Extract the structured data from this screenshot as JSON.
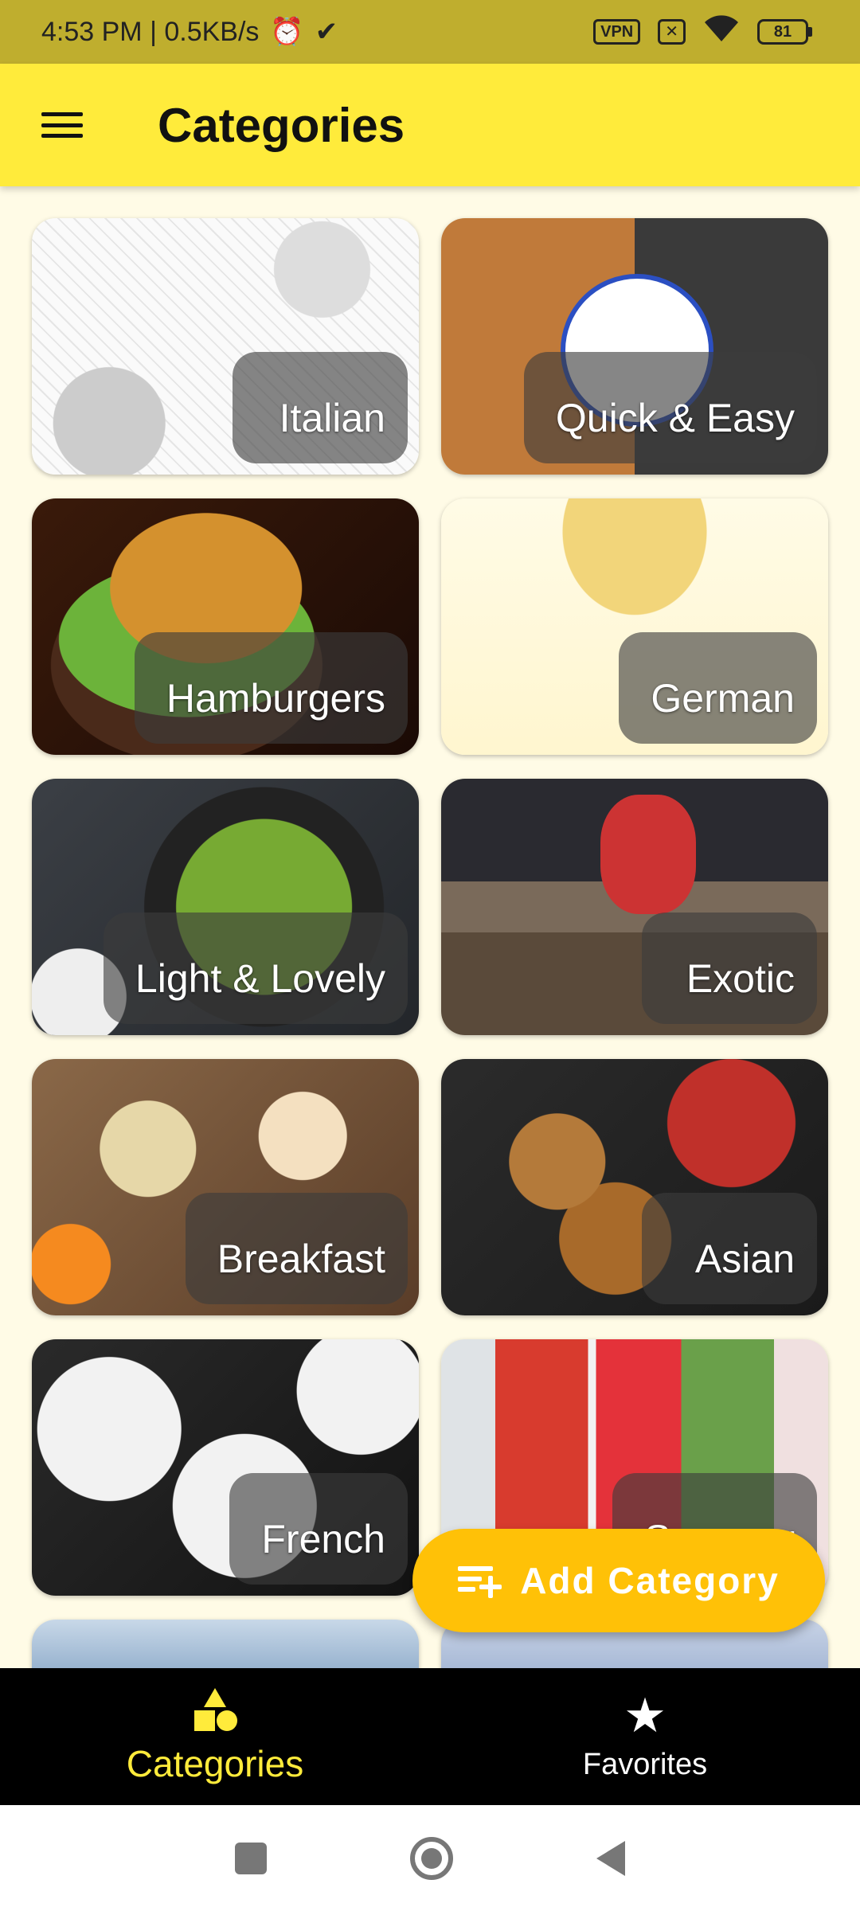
{
  "status_bar": {
    "time_speed": "4:53 PM | 0.5KB/s",
    "alarm_icon": "alarm-clock-icon",
    "vpn_badge": "VPN",
    "battery": "81"
  },
  "app_bar": {
    "title": "Categories",
    "menu_icon": "hamburger-menu-icon"
  },
  "categories": [
    {
      "label": "Italian"
    },
    {
      "label": "Quick & Easy"
    },
    {
      "label": "Hamburgers"
    },
    {
      "label": "German"
    },
    {
      "label": "Light & Lovely"
    },
    {
      "label": "Exotic"
    },
    {
      "label": "Breakfast"
    },
    {
      "label": "Asian"
    },
    {
      "label": "French"
    },
    {
      "label": "Summer"
    }
  ],
  "fab": {
    "label": "Add Category",
    "icon": "playlist-add-icon"
  },
  "bottom_nav": {
    "items": [
      {
        "label": "Categories",
        "icon": "category-shapes-icon",
        "active": true
      },
      {
        "label": "Favorites",
        "icon": "star-icon",
        "active": false
      }
    ]
  },
  "colors": {
    "accent": "#FFEB3B",
    "fab": "#FFC107",
    "status_bar": "#BFAE2E",
    "background": "#FFFBE6",
    "nav_background": "#000000"
  }
}
